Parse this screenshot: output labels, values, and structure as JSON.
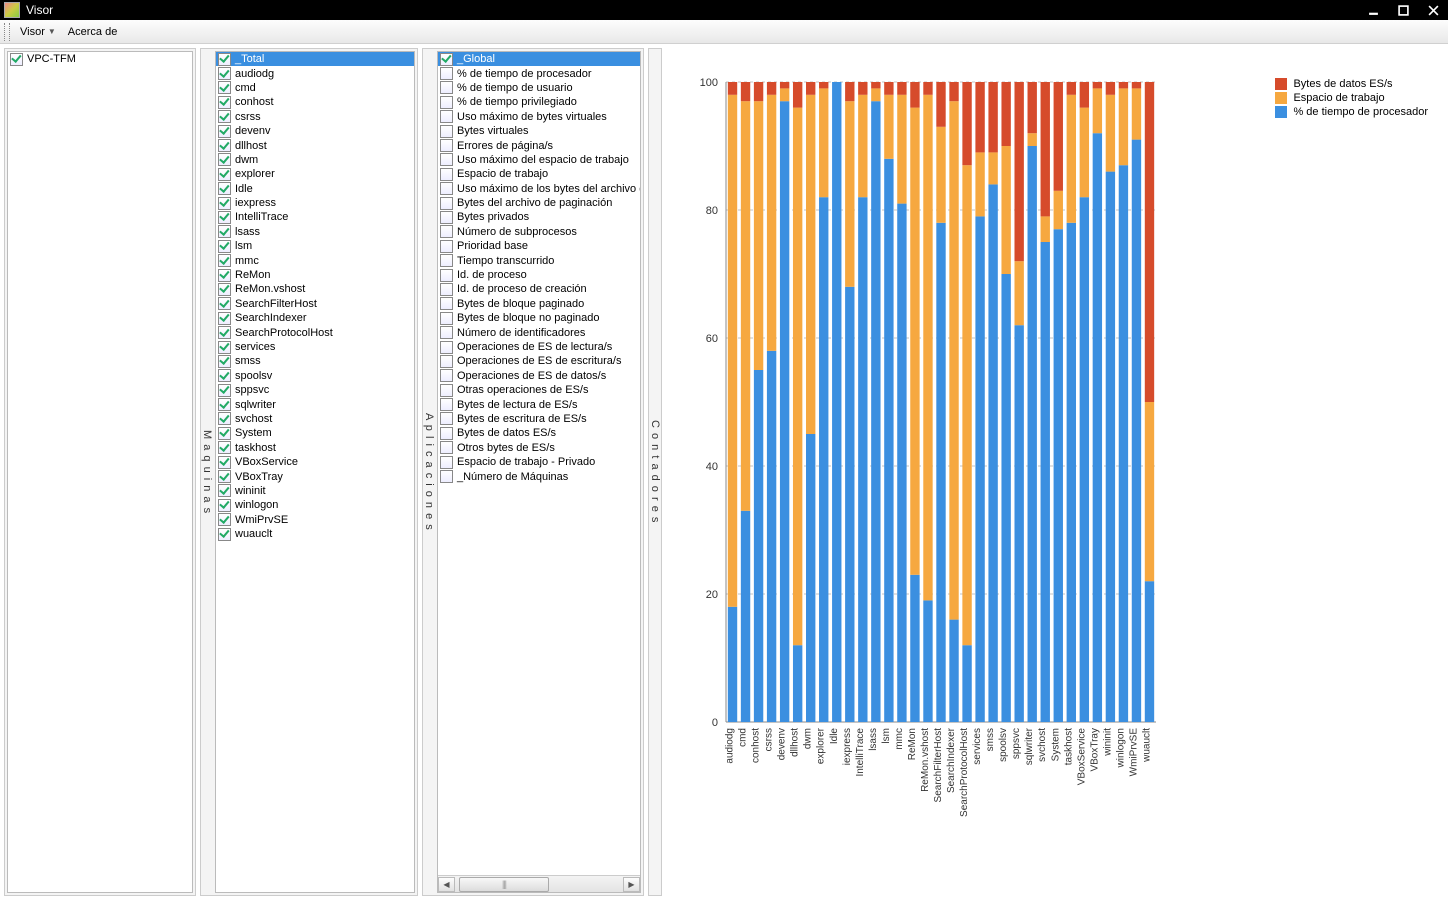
{
  "window": {
    "title": "Visor"
  },
  "menu": {
    "item1": "Visor",
    "item2": "Acerca de"
  },
  "machines": {
    "label": "M a q u i n a s",
    "items": [
      {
        "label": "VPC-TFM",
        "checked": true,
        "selected": false
      }
    ]
  },
  "apps": {
    "label": "A p l i c a c i o n e s",
    "items": [
      {
        "label": "_Total",
        "checked": true,
        "selected": true
      },
      {
        "label": "audiodg",
        "checked": true
      },
      {
        "label": "cmd",
        "checked": true
      },
      {
        "label": "conhost",
        "checked": true
      },
      {
        "label": "csrss",
        "checked": true
      },
      {
        "label": "devenv",
        "checked": true
      },
      {
        "label": "dllhost",
        "checked": true
      },
      {
        "label": "dwm",
        "checked": true
      },
      {
        "label": "explorer",
        "checked": true
      },
      {
        "label": "Idle",
        "checked": true
      },
      {
        "label": "iexpress",
        "checked": true
      },
      {
        "label": "IntelliTrace",
        "checked": true
      },
      {
        "label": "lsass",
        "checked": true
      },
      {
        "label": "lsm",
        "checked": true
      },
      {
        "label": "mmc",
        "checked": true
      },
      {
        "label": "ReMon",
        "checked": true
      },
      {
        "label": "ReMon.vshost",
        "checked": true
      },
      {
        "label": "SearchFilterHost",
        "checked": true
      },
      {
        "label": "SearchIndexer",
        "checked": true
      },
      {
        "label": "SearchProtocolHost",
        "checked": true
      },
      {
        "label": "services",
        "checked": true
      },
      {
        "label": "smss",
        "checked": true
      },
      {
        "label": "spoolsv",
        "checked": true
      },
      {
        "label": "sppsvc",
        "checked": true
      },
      {
        "label": "sqlwriter",
        "checked": true
      },
      {
        "label": "svchost",
        "checked": true
      },
      {
        "label": "System",
        "checked": true
      },
      {
        "label": "taskhost",
        "checked": true
      },
      {
        "label": "VBoxService",
        "checked": true
      },
      {
        "label": "VBoxTray",
        "checked": true
      },
      {
        "label": "wininit",
        "checked": true
      },
      {
        "label": "winlogon",
        "checked": true
      },
      {
        "label": "WmiPrvSE",
        "checked": true
      },
      {
        "label": "wuauclt",
        "checked": true
      }
    ]
  },
  "counters": {
    "label": "C o n t a d o r e s",
    "items": [
      {
        "label": "_Global",
        "checked": true,
        "selected": true
      },
      {
        "label": "% de tiempo de procesador"
      },
      {
        "label": "% de tiempo de usuario"
      },
      {
        "label": "% de tiempo privilegiado"
      },
      {
        "label": "Uso máximo de bytes virtuales"
      },
      {
        "label": "Bytes virtuales"
      },
      {
        "label": "Errores de página/s"
      },
      {
        "label": "Uso máximo del espacio de trabajo"
      },
      {
        "label": "Espacio de trabajo"
      },
      {
        "label": "Uso máximo de los bytes del archivo de paginación"
      },
      {
        "label": "Bytes del archivo de paginación"
      },
      {
        "label": "Bytes privados"
      },
      {
        "label": "Número de subprocesos"
      },
      {
        "label": "Prioridad base"
      },
      {
        "label": "Tiempo transcurrido"
      },
      {
        "label": "Id. de proceso"
      },
      {
        "label": "Id. de proceso de creación"
      },
      {
        "label": "Bytes de bloque paginado"
      },
      {
        "label": "Bytes de bloque no paginado"
      },
      {
        "label": "Número de identificadores"
      },
      {
        "label": "Operaciones de ES de lectura/s"
      },
      {
        "label": "Operaciones de ES de escritura/s"
      },
      {
        "label": "Operaciones de ES de datos/s"
      },
      {
        "label": "Otras operaciones de ES/s"
      },
      {
        "label": "Bytes de lectura de ES/s"
      },
      {
        "label": "Bytes de escritura de ES/s"
      },
      {
        "label": "Bytes de datos ES/s"
      },
      {
        "label": "Otros bytes de ES/s"
      },
      {
        "label": "Espacio de trabajo - Privado"
      },
      {
        "label": "_Número de Máquinas"
      }
    ]
  },
  "chart_data": {
    "type": "bar",
    "stacked": true,
    "ylim": [
      0,
      100
    ],
    "yticks": [
      0,
      20,
      40,
      60,
      80,
      100
    ],
    "categories": [
      "audiodg",
      "cmd",
      "conhost",
      "csrss",
      "devenv",
      "dllhost",
      "dwm",
      "explorer",
      "Idle",
      "iexpress",
      "IntelliTrace",
      "lsass",
      "lsm",
      "mmc",
      "ReMon",
      "ReMon.vshost",
      "SearchFilterHost",
      "SearchIndexer",
      "SearchProtocolHost",
      "services",
      "smss",
      "spoolsv",
      "sppsvc",
      "sqlwriter",
      "svchost",
      "System",
      "taskhost",
      "VBoxService",
      "VBoxTray",
      "wininit",
      "winlogon",
      "WmiPrvSE",
      "wuauclt"
    ],
    "series": [
      {
        "name": "% de tiempo de procesador",
        "color": "#3b8fe0",
        "values": [
          18,
          33,
          55,
          58,
          97,
          12,
          45,
          82,
          100,
          68,
          82,
          97,
          88,
          81,
          23,
          19,
          78,
          16,
          12,
          79,
          84,
          70,
          62,
          90,
          75,
          77,
          78,
          82,
          92,
          86,
          87,
          91,
          22
        ]
      },
      {
        "name": "Espacio de trabajo",
        "color": "#f6a840",
        "values": [
          80,
          64,
          42,
          40,
          2,
          84,
          53,
          17,
          0,
          29,
          16,
          2,
          10,
          17,
          73,
          79,
          15,
          81,
          75,
          10,
          5,
          20,
          10,
          2,
          4,
          6,
          20,
          14,
          7,
          12,
          12,
          8,
          28
        ]
      },
      {
        "name": "Bytes de datos ES/s",
        "color": "#d64b2b",
        "values": [
          2,
          3,
          3,
          2,
          1,
          4,
          2,
          1,
          0,
          3,
          2,
          1,
          2,
          2,
          4,
          2,
          7,
          3,
          13,
          11,
          11,
          10,
          28,
          8,
          21,
          17,
          2,
          4,
          1,
          2,
          1,
          1,
          50
        ]
      }
    ],
    "legend": [
      {
        "label": "Bytes de datos ES/s",
        "color": "#d64b2b"
      },
      {
        "label": "Espacio de trabajo",
        "color": "#f6a840"
      },
      {
        "label": "% de tiempo de procesador",
        "color": "#3b8fe0"
      }
    ]
  }
}
